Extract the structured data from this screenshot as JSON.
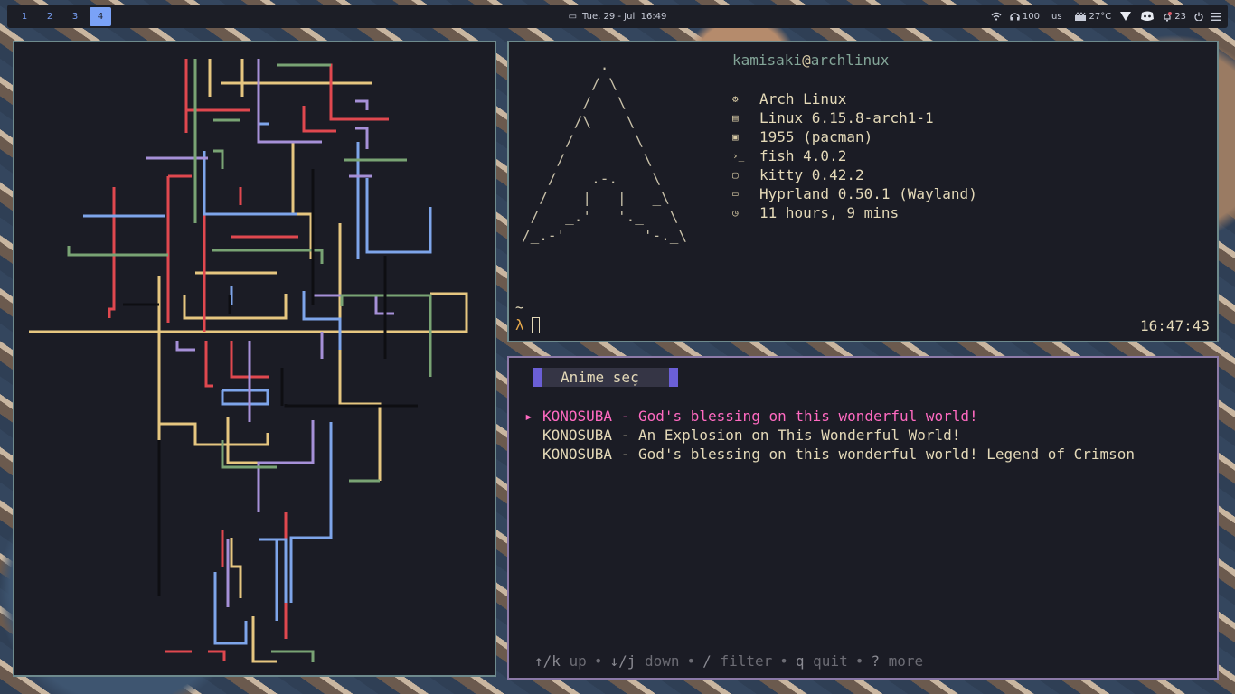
{
  "topbar": {
    "workspaces": [
      {
        "label": "1",
        "active": false
      },
      {
        "label": "2",
        "active": false
      },
      {
        "label": "3",
        "active": false
      },
      {
        "label": "4",
        "active": true
      }
    ],
    "clock_icon": "calendar-icon",
    "datetime": "Tue, 29 - Jul  16:49",
    "wifi_icon": "wifi-icon",
    "headphones_icon": "headphones-icon",
    "volume": "100",
    "keyboard_layout": "us",
    "weather_icon": "weather-icon",
    "temperature": "27°C",
    "shield_icon": "shield-icon",
    "discord_icon": "discord-icon",
    "notification_icon": "bell-icon",
    "notifications": "23",
    "power_icon": "power-icon",
    "menu_icon": "menu-icon",
    "accent": "#7aa2f7"
  },
  "fetch": {
    "user": "kamisaki",
    "at": "@",
    "host": "archlinux",
    "logo": "         .\n        / \\\n       /   \\\n      /\\    \\\n     /       \\\n    /         \\\n   /    .-.    \\\n  /    |   |   _\\\n /   _.'   '._   \\\n/_.-'         '-._\\",
    "rows": [
      {
        "icon": "gear-icon",
        "glyph": "⚙",
        "text": "Arch Linux"
      },
      {
        "icon": "chip-icon",
        "glyph": "▤",
        "text": "Linux 6.15.8-arch1-1"
      },
      {
        "icon": "package-icon",
        "glyph": "▣",
        "text": "1955 (pacman)"
      },
      {
        "icon": "terminal-icon",
        "glyph": "›_",
        "text": "fish 4.0.2"
      },
      {
        "icon": "terminal-box-icon",
        "glyph": "▢",
        "text": "kitty 0.42.2"
      },
      {
        "icon": "window-icon",
        "glyph": "▭",
        "text": "Hyprland 0.50.1 (Wayland)"
      },
      {
        "icon": "clock-icon",
        "glyph": "◷",
        "text": "11 hours, 9 mins"
      }
    ],
    "prompt_path": "~",
    "prompt_symbol": "λ",
    "right_time": "16:47:43"
  },
  "picker": {
    "title": "Anime seç",
    "selected_index": 0,
    "pointer": "▸",
    "items": [
      "KONOSUBA - God's blessing on this wonderful world!",
      "KONOSUBA - An Explosion on This Wonderful World!",
      "KONOSUBA - God's blessing on this wonderful world! Legend of Crimson"
    ],
    "help": [
      {
        "key": "↑/k",
        "label": "up"
      },
      {
        "sep": "•"
      },
      {
        "key": "↓/j",
        "label": "down"
      },
      {
        "sep": "•"
      },
      {
        "key": "/",
        "label": "filter"
      },
      {
        "sep": "•"
      },
      {
        "key": "q",
        "label": "quit"
      },
      {
        "sep": "•"
      },
      {
        "key": "?",
        "label": "more"
      }
    ]
  },
  "pipes": {
    "colors": [
      "#e0484f",
      "#e6c680",
      "#7ea5ea",
      "#a690d8",
      "#79a374",
      "#0e0e12"
    ]
  }
}
